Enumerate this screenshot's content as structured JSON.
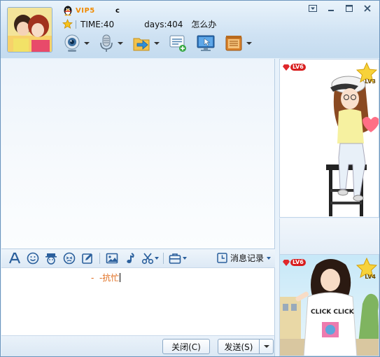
{
  "header": {
    "vip_label": "VIP5",
    "name_fragment": "c",
    "time_text": "TIME:40",
    "days_text": "days:404",
    "mood_text": "怎么办"
  },
  "toolbar": {
    "items": [
      "webcam-icon",
      "microphone-icon",
      "send-file-icon",
      "group-message-icon",
      "remote-desktop-icon",
      "app-box-icon"
    ]
  },
  "window_controls": [
    "menu-icon",
    "minimize-icon",
    "maximize-icon",
    "close-icon"
  ],
  "format_bar": {
    "icons": [
      "font-icon",
      "emoji-icon",
      "magic-face-icon",
      "shake-icon",
      "scrawl-icon",
      "image-icon",
      "music-icon",
      "screenshot-icon",
      "toolbox-icon"
    ],
    "history_label": "消息记录"
  },
  "input": {
    "text": "-  -抗忙"
  },
  "buttons": {
    "close_label": "关闭(C)",
    "send_label": "发送(S)"
  },
  "show_panels": {
    "top": {
      "vip_level": "LV6",
      "star_level": "LV3"
    },
    "bottom": {
      "vip_level": "LV6",
      "star_level": "LV4",
      "shirt_text": "CLICK CLICK"
    }
  },
  "colors": {
    "accent": "#f08a00",
    "input_text": "#e06a19",
    "frame": "#6c95bd"
  }
}
